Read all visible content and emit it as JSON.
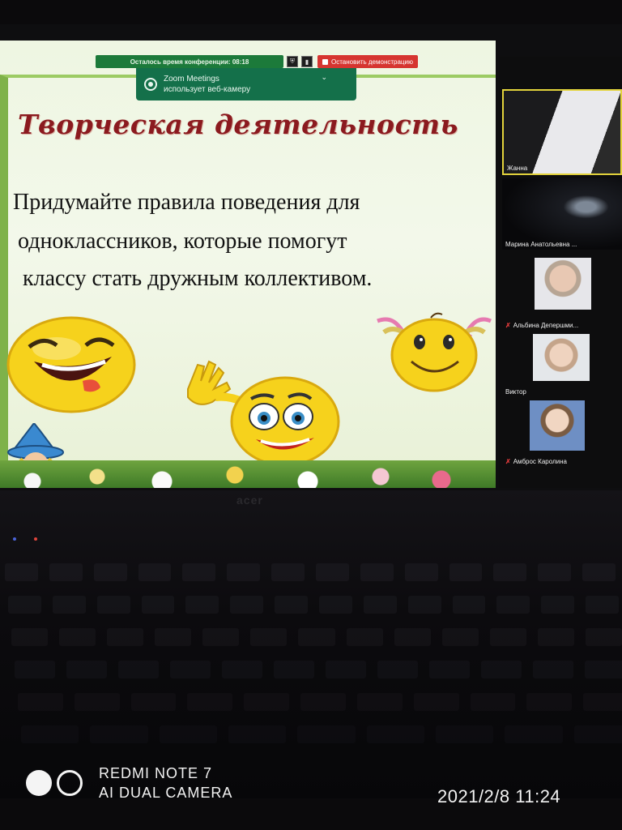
{
  "zoom_bar": {
    "timer_text": "Осталось время конференции: 08:18",
    "stop_share_label": "Остановить демонстрацию"
  },
  "webcam_notice": {
    "app_name": "Zoom Meetings",
    "message": "использует веб-камеру"
  },
  "slide": {
    "title": "Творческая деятельность",
    "lines": [
      "Придумайте правила поведения для",
      "одноклассников, которые помогут",
      "классу стать дружным коллективом."
    ]
  },
  "participants": [
    {
      "name": "Жанна",
      "muted": false
    },
    {
      "name": "Марина Анатольевна ...",
      "muted": false
    },
    {
      "name": "Альбина Депершми...",
      "muted": true
    },
    {
      "name": "Виктор",
      "muted": false
    },
    {
      "name": "Амброс Каролина",
      "muted": true
    }
  ],
  "laptop": {
    "brand": "acer"
  },
  "watermark": {
    "model": "REDMI NOTE 7",
    "camera": "AI DUAL CAMERA",
    "timestamp": "2021/2/8  11:24"
  },
  "colors": {
    "title_red": "#8b1a1f",
    "zoom_green": "#1c7a3a",
    "stop_red": "#d63530",
    "active_speaker_border": "#e3d33c",
    "smiley_yellow": "#f6d21c"
  }
}
